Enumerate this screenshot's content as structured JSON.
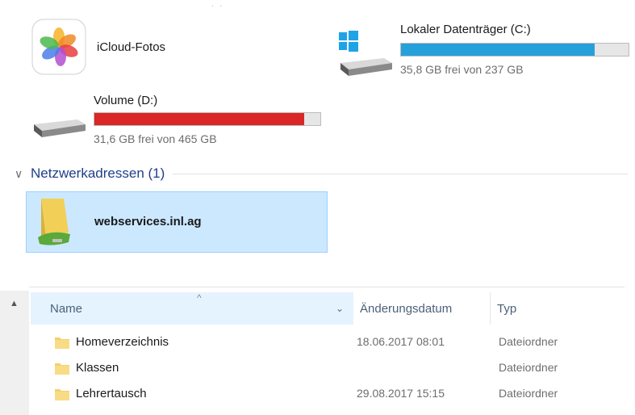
{
  "devices": {
    "icloud": {
      "name": "iCloud-Fotos",
      "icon": "photos-icon"
    },
    "drive_c": {
      "name": "Lokaler Datenträger (C:)",
      "free_text": "35,8 GB frei von 237 GB",
      "used_fraction": 0.85,
      "bar_color": "#26a0da",
      "icon": "windows-drive-icon"
    },
    "drive_d": {
      "name": "Volume (D:)",
      "free_text": "31,6 GB frei von 465 GB",
      "used_fraction": 0.93,
      "bar_color": "#da2626",
      "icon": "hard-drive-icon"
    }
  },
  "network_group": {
    "title": "Netzwerkadressen (1)",
    "items": [
      {
        "name": "webservices.inl.ag",
        "icon": "network-folder-icon"
      }
    ]
  },
  "file_list": {
    "columns": {
      "name": "Name",
      "date": "Änderungsdatum",
      "type": "Typ"
    },
    "rows": [
      {
        "name": "Homeverzeichnis",
        "date": "18.06.2017 08:01",
        "type": "Dateiordner"
      },
      {
        "name": "Klassen",
        "date": "",
        "type": "Dateiordner"
      },
      {
        "name": "Lehrertausch",
        "date": "29.08.2017 15:15",
        "type": "Dateiordner"
      }
    ]
  },
  "colors": {
    "accent": "#26a0da",
    "warning": "#da2626",
    "selection": "#cce8ff",
    "group_title": "#1e3f8a"
  }
}
